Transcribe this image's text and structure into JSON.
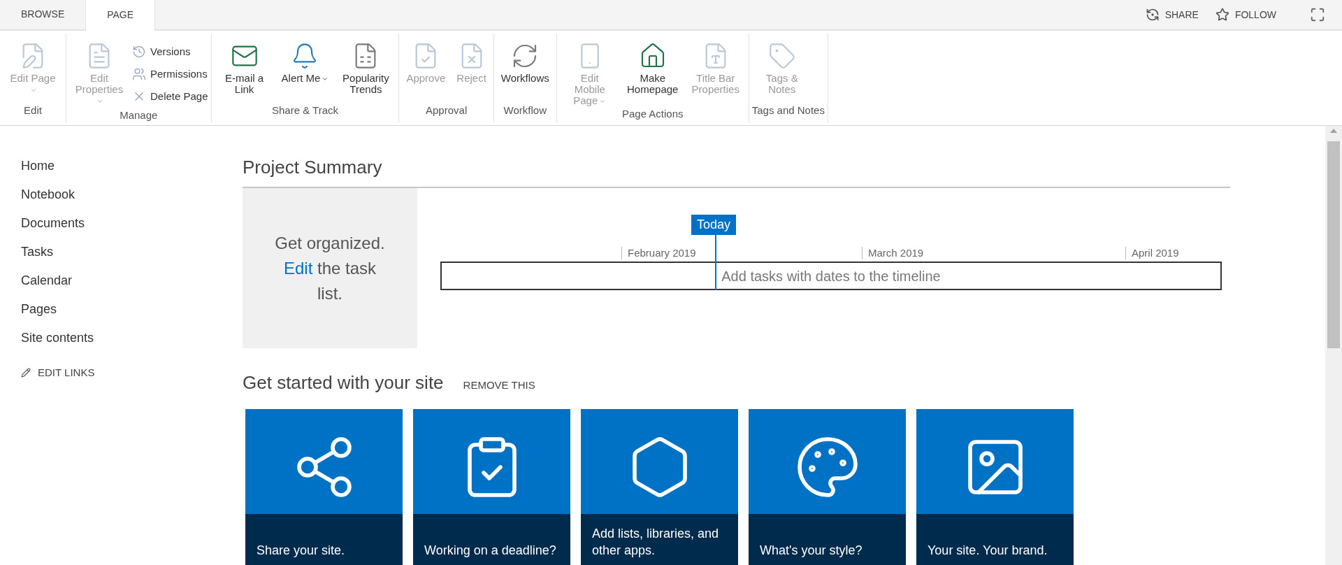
{
  "tabs": [
    {
      "label": "BROWSE",
      "selected": false
    },
    {
      "label": "PAGE",
      "selected": true
    }
  ],
  "top_actions": [
    {
      "label": "SHARE"
    },
    {
      "label": "FOLLOW"
    }
  ],
  "ribbon_groups": [
    {
      "label": "Edit",
      "buttons": [
        {
          "kind": "large",
          "label": "Edit Page",
          "disabled": true,
          "has_menu": true
        }
      ]
    },
    {
      "label": "Manage",
      "buttons": [
        {
          "kind": "large",
          "label": "Edit Properties",
          "disabled": true,
          "has_menu": true
        },
        {
          "kind": "small",
          "label": "Versions",
          "disabled": false,
          "has_menu": false
        },
        {
          "kind": "small",
          "label": "Permissions",
          "disabled": false,
          "has_menu": false
        },
        {
          "kind": "small",
          "label": "Delete Page",
          "disabled": false,
          "has_menu": false
        }
      ]
    },
    {
      "label": "Share & Track",
      "buttons": [
        {
          "kind": "large",
          "label": "E-mail a Link",
          "disabled": false,
          "has_menu": false
        },
        {
          "kind": "large",
          "label": "Alert Me",
          "disabled": false,
          "has_menu": true
        },
        {
          "kind": "large",
          "label": "Popularity Trends",
          "disabled": false,
          "has_menu": false
        }
      ]
    },
    {
      "label": "Approval",
      "buttons": [
        {
          "kind": "large",
          "label": "Approve",
          "disabled": true,
          "has_menu": false
        },
        {
          "kind": "large",
          "label": "Reject",
          "disabled": true,
          "has_menu": false
        }
      ]
    },
    {
      "label": "Workflow",
      "buttons": [
        {
          "kind": "large",
          "label": "Workflows",
          "disabled": false,
          "has_menu": false
        }
      ]
    },
    {
      "label": "Page Actions",
      "buttons": [
        {
          "kind": "large",
          "label": "Edit Mobile Page",
          "disabled": true,
          "has_menu": true
        },
        {
          "kind": "large",
          "label": "Make Homepage",
          "disabled": false,
          "has_menu": false
        },
        {
          "kind": "large",
          "label": "Title Bar Properties",
          "disabled": true,
          "has_menu": false
        }
      ]
    },
    {
      "label": "Tags and Notes",
      "buttons": [
        {
          "kind": "large",
          "label": "Tags & Notes",
          "disabled": true,
          "has_menu": false
        }
      ]
    }
  ],
  "nav": {
    "items": [
      "Home",
      "Notebook",
      "Documents",
      "Tasks",
      "Calendar",
      "Pages",
      "Site contents"
    ],
    "edit_links": "EDIT LINKS"
  },
  "project_summary": {
    "title": "Project Summary",
    "prompt_before": "Get organized.",
    "prompt_link": "Edit",
    "prompt_after": "the task list.",
    "timeline": {
      "today": "Today",
      "months": [
        "February 2019",
        "March 2019",
        "April 2019"
      ],
      "placeholder": "Add tasks with dates to the timeline"
    }
  },
  "get_started": {
    "title": "Get started with your site",
    "remove": "REMOVE THIS",
    "tiles": [
      "Share your site.",
      "Working on a deadline?",
      "Add lists, libraries, and other apps.",
      "What's your style?",
      "Your site. Your brand."
    ]
  }
}
